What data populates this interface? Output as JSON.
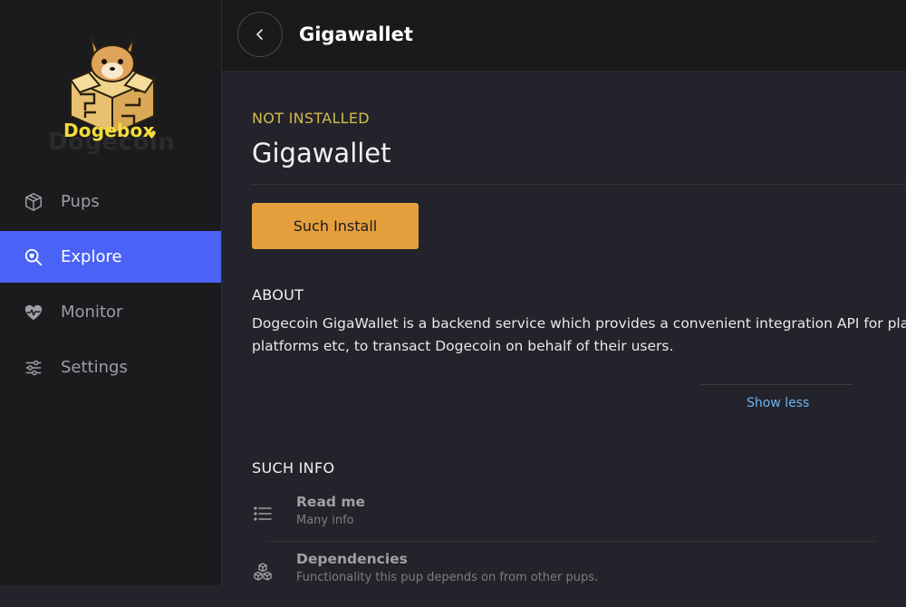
{
  "brand": {
    "name": "Dogebox",
    "ghost_text": "Dogecoin"
  },
  "nav": {
    "items": [
      {
        "label": "Pups",
        "icon": "box-icon",
        "active": false
      },
      {
        "label": "Explore",
        "icon": "explore-search-icon",
        "active": true
      },
      {
        "label": "Monitor",
        "icon": "heart-pulse-icon",
        "active": false
      },
      {
        "label": "Settings",
        "icon": "sliders-icon",
        "active": false
      }
    ]
  },
  "header": {
    "title": "Gigawallet",
    "back_icon": "chevron-left-icon"
  },
  "pup": {
    "status": "NOT INSTALLED",
    "name": "Gigawallet",
    "install_label": "Such Install"
  },
  "about": {
    "heading": "ABOUT",
    "line1": "Dogecoin GigaWallet is a backend service which provides a convenient integration API for platforms such as online shops, exchanges, social media",
    "line2": "platforms etc, to transact Dogecoin on behalf of their users.",
    "toggle_label": "Show less"
  },
  "info": {
    "heading": "SUCH INFO",
    "items": [
      {
        "title": "Read me",
        "subtitle": "Many info",
        "icon": "list-icon"
      },
      {
        "title": "Dependencies",
        "subtitle": "Functionality this pup depends on from other pups.",
        "icon": "cubes-icon"
      }
    ]
  },
  "colors": {
    "accent": "#4a62f5",
    "install": "#e59f3c",
    "status": "#d7ba4f",
    "link": "#6fb3f2",
    "brand_yellow": "#f3dc3a"
  }
}
